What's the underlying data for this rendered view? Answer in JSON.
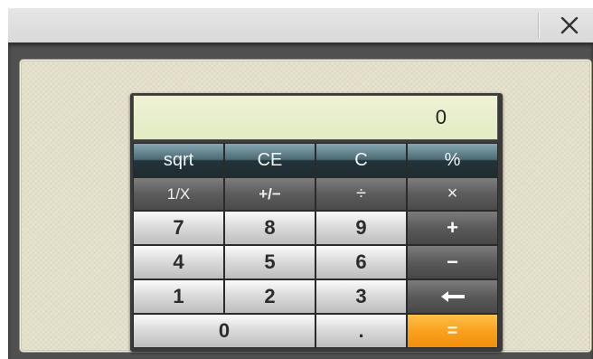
{
  "window": {
    "close_icon": "close-icon"
  },
  "display": {
    "value": "0"
  },
  "keys": {
    "sqrt": "sqrt",
    "ce": "CE",
    "c": "C",
    "percent": "%",
    "reciprocal": "1/X",
    "negate": "+/−",
    "divide": "÷",
    "multiply": "×",
    "seven": "7",
    "eight": "8",
    "nine": "9",
    "plus": "+",
    "four": "4",
    "five": "5",
    "six": "6",
    "minus": "−",
    "one": "1",
    "two": "2",
    "three": "3",
    "backspace_icon": "backspace-arrow-icon",
    "zero": "0",
    "decimal": ".",
    "equals": "="
  },
  "colors": {
    "equals_key": "#f9a21e",
    "display_bg": "#e8efcc",
    "function_keys": "#4c6a74"
  }
}
